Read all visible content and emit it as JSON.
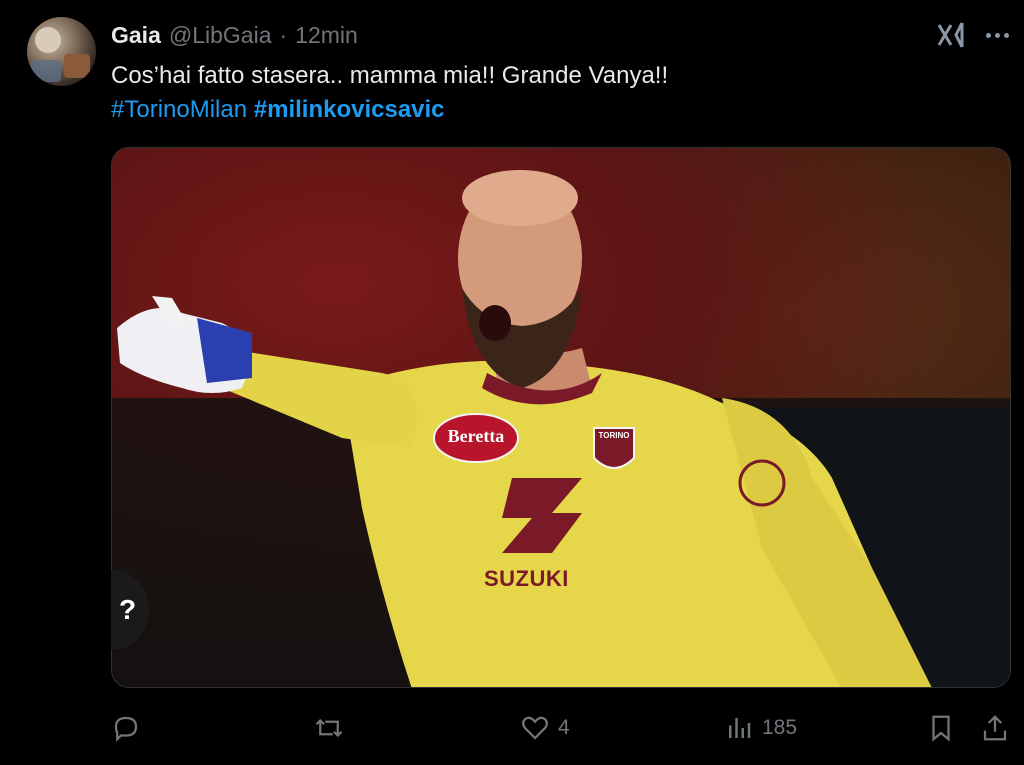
{
  "post": {
    "author": {
      "name": "Gaia",
      "handle": "@LibGaia",
      "separator": "·",
      "time": "12min"
    },
    "text": "Cos’hai fatto stasera.. mamma mia!! Grande Vanya!!",
    "hashtags": [
      {
        "label": "#TorinoMilan",
        "weight": "normal"
      },
      {
        "label": "#milinkovicsavic",
        "weight": "bold"
      }
    ],
    "media": {
      "jersey_sponsor": "SUZUKI",
      "jersey_brand": "Beretta",
      "crest_text": "TORINO",
      "jersey_color": "#e8d84a",
      "accent_color": "#7a1a28"
    },
    "overlay_button": "?"
  },
  "actions": {
    "reply": {
      "icon": "reply-icon",
      "count": ""
    },
    "repost": {
      "icon": "repost-icon",
      "count": ""
    },
    "like": {
      "icon": "heart-icon",
      "count": "4"
    },
    "views": {
      "icon": "views-icon",
      "count": "185"
    },
    "bookmark": {
      "icon": "bookmark-icon"
    },
    "share": {
      "icon": "share-icon"
    }
  },
  "colors": {
    "background": "#000000",
    "text": "#e7e9ea",
    "muted": "#71767b",
    "link": "#1d9bf0"
  }
}
